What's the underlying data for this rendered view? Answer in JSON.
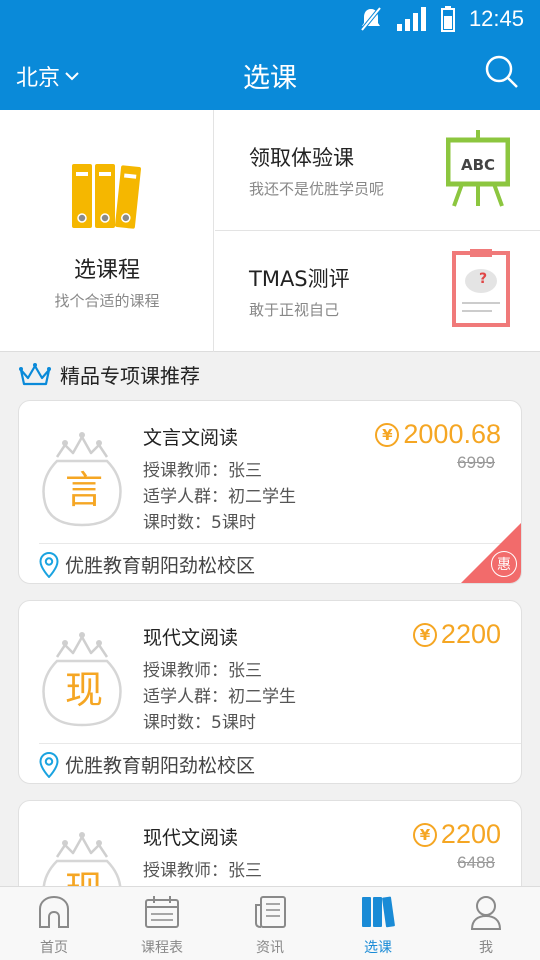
{
  "status_bar": {
    "time": "12:45"
  },
  "header": {
    "city": "北京",
    "title": "选课"
  },
  "top_grid": {
    "choose": {
      "title": "选课程",
      "subtitle": "找个合适的课程"
    },
    "trial": {
      "title": "领取体验课",
      "subtitle": "我还不是优胜学员呢",
      "icon_text": "ABC"
    },
    "tmas": {
      "title": "TMAS测评",
      "subtitle": "敢于正视自己"
    }
  },
  "section": {
    "title": "精品专项课推荐"
  },
  "courses": [
    {
      "badge": "言",
      "name": "文言文阅读",
      "price": "2000.68",
      "original_price": "6999",
      "teacher": "授课教师：张三",
      "audience": "适学人群：初二学生",
      "hours": "课时数：5课时",
      "location": "优胜教育朝阳劲松校区",
      "discount_tag": "惠"
    },
    {
      "badge": "现",
      "name": "现代文阅读",
      "price": "2200",
      "original_price": "",
      "teacher": "授课教师：张三",
      "audience": "适学人群：初二学生",
      "hours": "课时数：5课时",
      "location": "优胜教育朝阳劲松校区"
    },
    {
      "badge": "现",
      "name": "现代文阅读",
      "price": "2200",
      "original_price": "6488",
      "teacher": "授课教师：张三",
      "audience": "",
      "hours": "",
      "location": ""
    }
  ],
  "bottom_nav": [
    {
      "label": "首页",
      "icon": "home-icon"
    },
    {
      "label": "课程表",
      "icon": "calendar-icon"
    },
    {
      "label": "资讯",
      "icon": "news-icon"
    },
    {
      "label": "选课",
      "icon": "books-icon",
      "active": true
    },
    {
      "label": "我",
      "icon": "user-icon"
    }
  ],
  "colors": {
    "primary": "#0a8ad9",
    "accent": "#f5a623",
    "discount": "#f26b6b",
    "active_tab": "#1a8bd6"
  }
}
